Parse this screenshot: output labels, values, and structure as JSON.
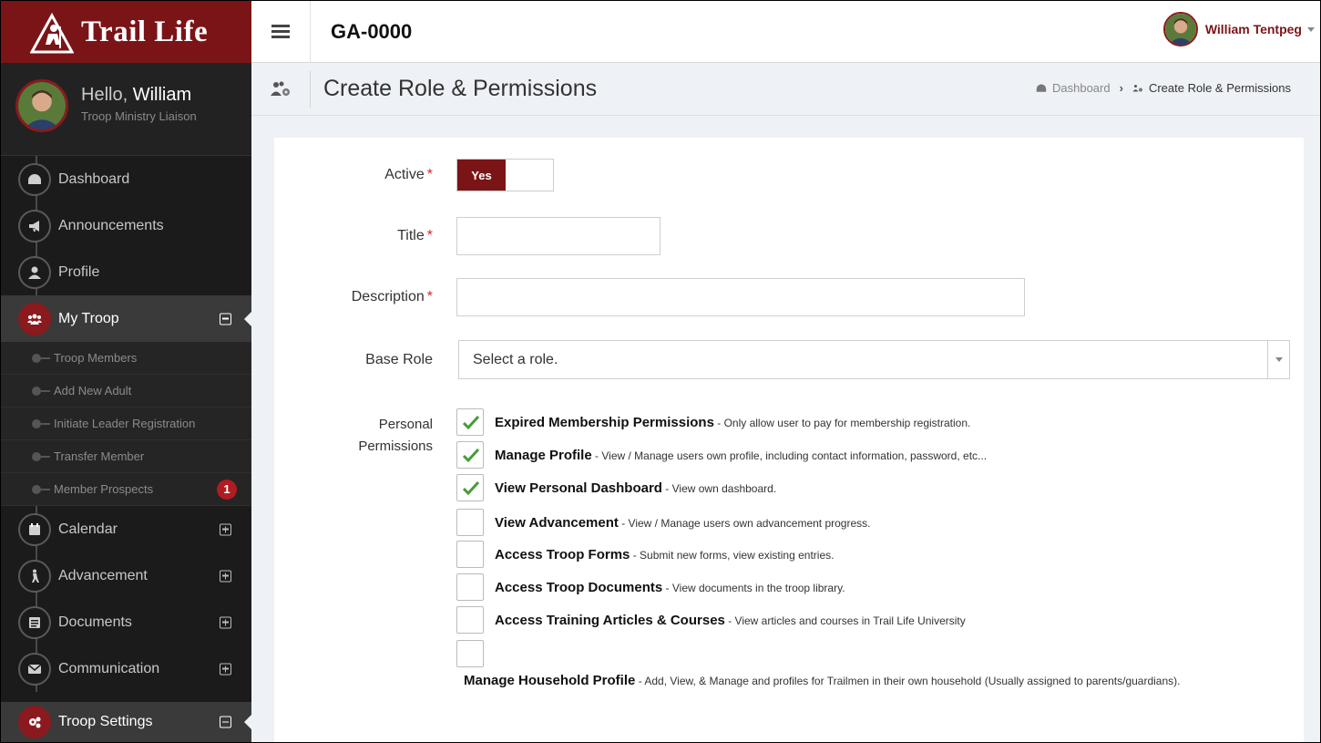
{
  "brand": {
    "name": "Trail Life",
    "color": "#7b1417"
  },
  "user": {
    "greeting": "Hello,",
    "first_name": "William",
    "title": "Troop Ministry Liaison",
    "full_name": "William Tentpeg"
  },
  "topbar": {
    "org_code": "GA-0000"
  },
  "sidebar": {
    "items": [
      {
        "label": "Dashboard",
        "icon": "dashboard-icon"
      },
      {
        "label": "Announcements",
        "icon": "megaphone-icon"
      },
      {
        "label": "Profile",
        "icon": "user-icon"
      },
      {
        "label": "My Troop",
        "icon": "group-icon",
        "active": true
      }
    ],
    "troop_sub": [
      {
        "label": "Troop Members"
      },
      {
        "label": "Add New Adult"
      },
      {
        "label": "Initiate Leader Registration"
      },
      {
        "label": "Transfer Member"
      },
      {
        "label": "Member Prospects",
        "badge": "1"
      }
    ],
    "more": [
      {
        "label": "Calendar",
        "icon": "calendar-icon"
      },
      {
        "label": "Advancement",
        "icon": "hiker-icon"
      },
      {
        "label": "Documents",
        "icon": "document-icon"
      },
      {
        "label": "Communication",
        "icon": "envelope-icon"
      }
    ],
    "settings": {
      "label": "Troop Settings",
      "icon": "gears-icon"
    }
  },
  "page": {
    "title": "Create Role & Permissions",
    "breadcrumb": {
      "home": "Dashboard",
      "current": "Create Role & Permissions"
    }
  },
  "form": {
    "active_label": "Active",
    "active_value": "Yes",
    "title_label": "Title",
    "title_value": "",
    "description_label": "Description",
    "description_value": "",
    "base_role_label": "Base Role",
    "base_role_placeholder": "Select a role.",
    "required_mark": "*",
    "permissions_label_1": "Personal",
    "permissions_label_2": "Permissions",
    "permissions": [
      {
        "name": "Expired Membership Permissions",
        "desc": " - Only allow user to pay for membership registration.",
        "checked": true
      },
      {
        "name": "Manage Profile",
        "desc": " - View / Manage users own profile, including contact information, password, etc...",
        "checked": true
      },
      {
        "name": "View Personal Dashboard",
        "desc": " - View own dashboard.",
        "checked": true
      },
      {
        "name": "View Advancement",
        "desc": " - View / Manage users own advancement progress.",
        "checked": false
      },
      {
        "name": "Access Troop Forms",
        "desc": " - Submit new forms, view existing entries.",
        "checked": false
      },
      {
        "name": "Access Troop Documents",
        "desc": " - View documents in the troop library.",
        "checked": false
      },
      {
        "name": "Access Training Articles & Courses",
        "desc": " - View articles and courses in Trail Life University",
        "checked": false
      },
      {
        "name": "Manage Household Profile",
        "desc": " - Add, View, & Manage and profiles for Trailmen in their own household (Usually assigned to parents/guardians).",
        "checked": false
      }
    ]
  },
  "colors": {
    "accent": "#7b1417",
    "check": "#4a9a3a",
    "badge": "#b01c22"
  }
}
